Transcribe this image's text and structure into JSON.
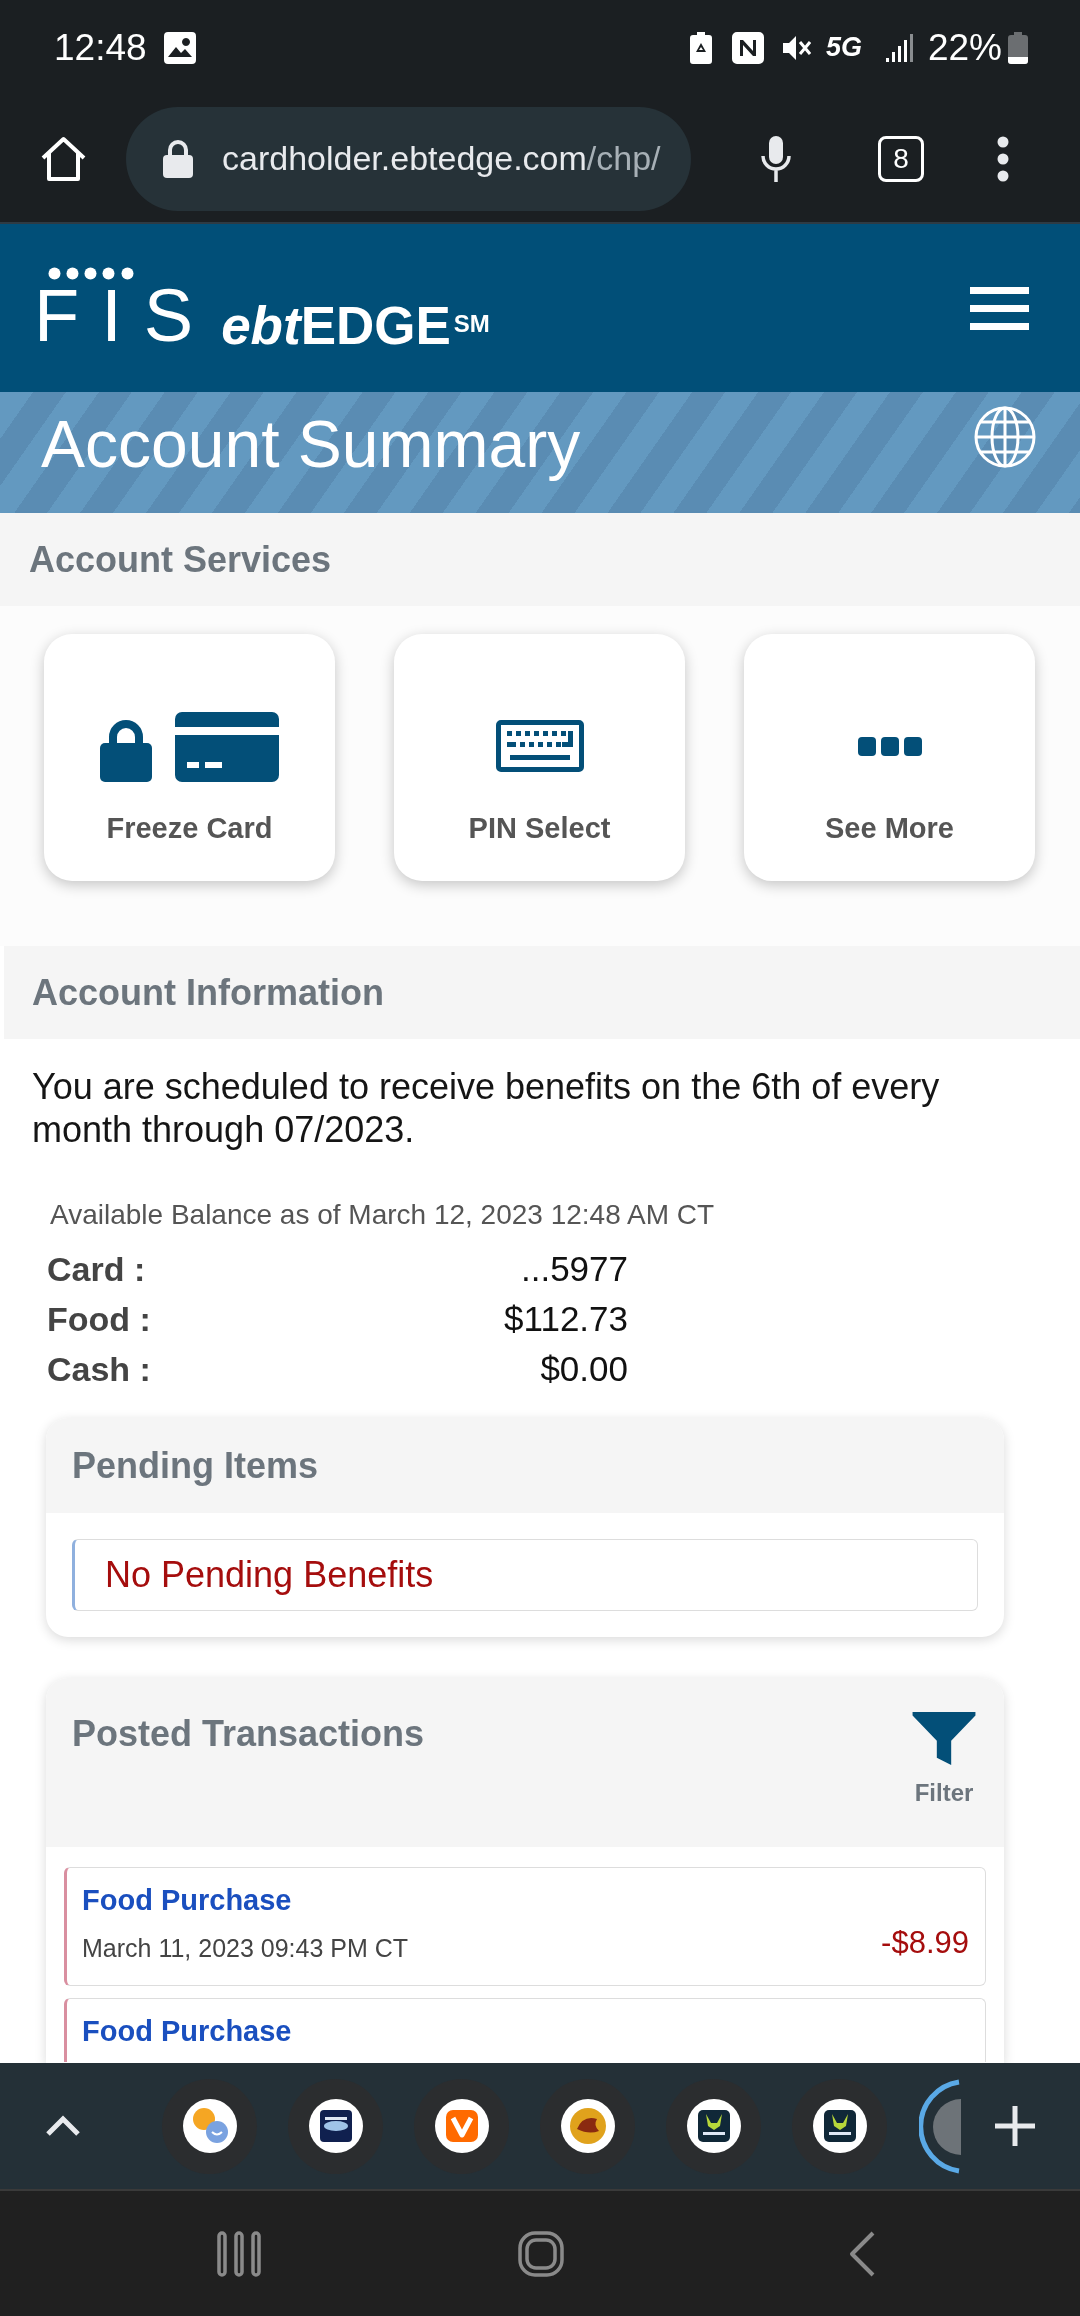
{
  "status_bar": {
    "time": "12:48",
    "network": "5G",
    "battery": "22%"
  },
  "browser": {
    "url_host": "cardholder.ebtedge.com",
    "url_path": "/chp/",
    "tab_count": "8"
  },
  "header": {
    "logo": "FIS",
    "product": {
      "prefix": "ebt",
      "name": "EDGE",
      "mark": "SM"
    }
  },
  "banner": {
    "title": "Account Summary"
  },
  "account_services": {
    "title": "Account Services",
    "actions": [
      {
        "kind": "freeze",
        "label": "Freeze Card"
      },
      {
        "kind": "pin",
        "label": "PIN Select"
      },
      {
        "kind": "more",
        "label": "See More"
      }
    ]
  },
  "account_information": {
    "title": "Account Information",
    "schedule": "You are scheduled to receive benefits on the 6th of every month through 07/2023.",
    "balance_caption": "Available Balance as of March 12, 2023 12:48 AM CT",
    "balances": [
      {
        "label": "Card :",
        "value": "...5977"
      },
      {
        "label": "Food :",
        "value": "$112.73"
      },
      {
        "label": "Cash :",
        "value": "$0.00"
      }
    ]
  },
  "pending_items": {
    "title": "Pending Items",
    "message": "No Pending Benefits"
  },
  "posted_transactions": {
    "title": "Posted Transactions",
    "filter": "Filter",
    "transactions": [
      {
        "title": "Food Purchase",
        "date": "March 11, 2023 09:43 PM CT",
        "amount": "-$8.99"
      },
      {
        "title": "Food Purchase"
      }
    ]
  },
  "tab_group": {
    "tabs": [
      {
        "kind": "chat"
      },
      {
        "kind": "puzzle"
      },
      {
        "kind": "chevron"
      },
      {
        "kind": "dragon"
      },
      {
        "kind": "casino"
      },
      {
        "kind": "casino"
      }
    ]
  }
}
